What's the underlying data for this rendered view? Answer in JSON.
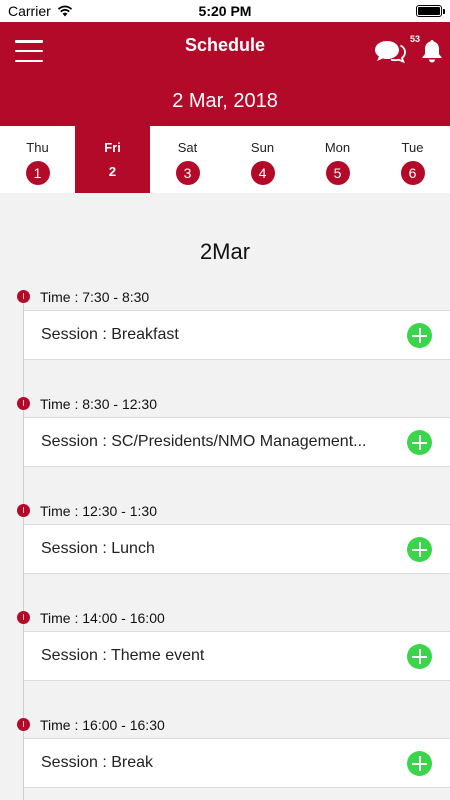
{
  "status_bar": {
    "carrier": "Carrier",
    "time": "5:20 PM"
  },
  "header": {
    "title": "Schedule",
    "notification_count": "53",
    "date": "2 Mar, 2018"
  },
  "days": [
    {
      "name": "Thu",
      "num": "1"
    },
    {
      "name": "Fri",
      "num": "2"
    },
    {
      "name": "Sat",
      "num": "3"
    },
    {
      "name": "Sun",
      "num": "4"
    },
    {
      "name": "Mon",
      "num": "5"
    },
    {
      "name": "Tue",
      "num": "6"
    }
  ],
  "selected_day": "Fri",
  "schedule": {
    "heading": "2Mar",
    "entries": [
      {
        "time": "Time : 7:30 - 8:30",
        "session": "Session : Breakfast"
      },
      {
        "time": "Time : 8:30 - 12:30",
        "session": "Session : SC/Presidents/NMO Management..."
      },
      {
        "time": "Time : 12:30 - 1:30",
        "session": "Session : Lunch"
      },
      {
        "time": "Time : 14:00 - 16:00",
        "session": "Session : Theme event"
      },
      {
        "time": "Time : 16:00 - 16:30",
        "session": "Session : Break"
      }
    ]
  },
  "colors": {
    "brand": "#b30a2a",
    "add": "#3ad54a",
    "background": "#f2f2f2"
  },
  "icons": {
    "menu": "hamburger-menu-icon",
    "chat": "chat-bubbles-icon",
    "notification": "bell-icon",
    "add": "plus-circle-icon",
    "timeline": "timeline-dot-icon"
  }
}
